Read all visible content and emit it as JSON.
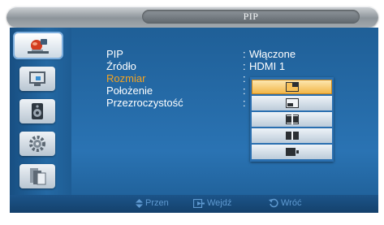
{
  "title": "PIP",
  "sidebar": {
    "items": [
      {
        "icon": "satellite-dish-icon",
        "active": true
      },
      {
        "icon": "picture-screen-icon"
      },
      {
        "icon": "speaker-icon"
      },
      {
        "icon": "gear-icon"
      },
      {
        "icon": "multi-page-icon"
      }
    ]
  },
  "menu": {
    "rows": [
      {
        "label": "PIP",
        "value": "Włączone"
      },
      {
        "label": "Źródło",
        "value": "HDMI 1"
      },
      {
        "label": "Rozmiar",
        "value": ""
      },
      {
        "label": "Położenie",
        "value": ""
      },
      {
        "label": "Przezroczystość",
        "value": ""
      }
    ],
    "colon": ":",
    "highlight_color": "#f4a321"
  },
  "dropdown": {
    "options": [
      {
        "icon": "pip-small-corner-icon",
        "selected": true
      },
      {
        "icon": "pip-large-corner-icon"
      },
      {
        "icon": "pip-split-icon"
      },
      {
        "icon": "pip-split-wide-icon"
      },
      {
        "icon": "pip-side-icon"
      }
    ]
  },
  "footer": {
    "move_label": "Przen",
    "enter_label": "Wejdź",
    "return_label": "Wróć"
  }
}
